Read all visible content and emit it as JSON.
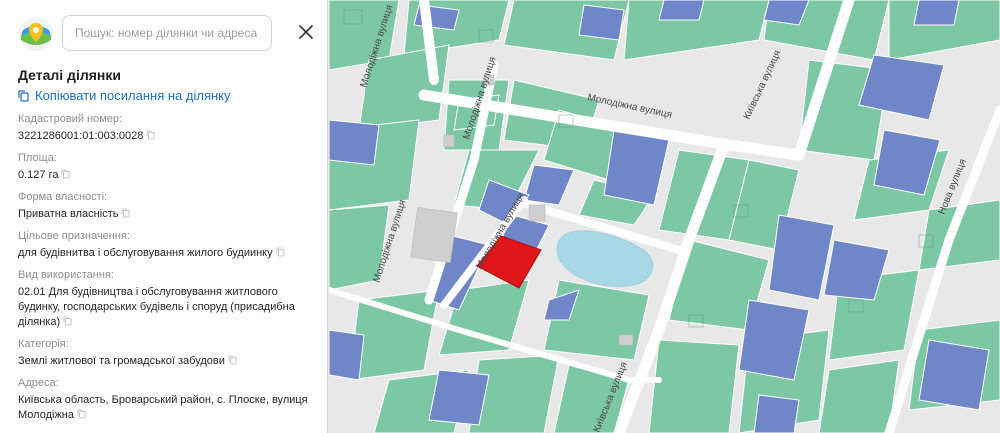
{
  "search": {
    "placeholder": "Пошук: номер ділянки чи адреса"
  },
  "panel": {
    "title": "Деталі ділянки",
    "copy_link": "Копіювати посилання на ділянку",
    "fields": [
      {
        "label": "Кадастровий номер:",
        "value": "3221286001:01:003:0028"
      },
      {
        "label": "Площа:",
        "value": "0.127 га"
      },
      {
        "label": "Форма власності:",
        "value": "Приватна власність"
      },
      {
        "label": "Цільове призначення:",
        "value": "для будівнитва і обслуговування жилого будиинку"
      },
      {
        "label": "Вид використання:",
        "value": "02.01 Для будівництва і обслуговування житлового будинку, господарських будівель і споруд (присадибна ділянка)"
      },
      {
        "label": "Категорія:",
        "value": "Землі житлової та громадської забудови"
      },
      {
        "label": "Адреса:",
        "value": "Київська область, Броварський район, с. Плоске, вулиця Молодіжна"
      }
    ]
  },
  "map": {
    "streets": {
      "molodizhna_1": "Молодіжна вулиця",
      "molodizhna_2": "Молодіжна вулиця",
      "molodizhna_3": "Молодіжна вулиця",
      "molodizhna_4": "Молодіжна вулиця",
      "molodizhna_5": "Молодіжна вулиця",
      "kyivska_1": "Київська вулиця",
      "kyivska_2": "Київська вулиця",
      "nova": "Нова вулиця"
    },
    "colors": {
      "green_parcel": "#7cc7a4",
      "blue_parcel": "#6f86c9",
      "selected_parcel": "#e0161b",
      "water": "#a8d8e6",
      "road": "#ffffff",
      "background": "#e8e8e8"
    }
  }
}
